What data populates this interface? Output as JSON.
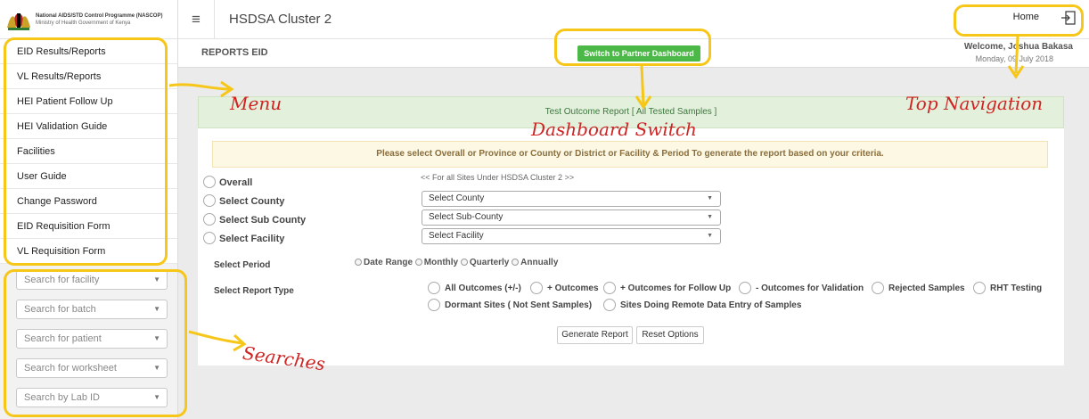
{
  "brand": {
    "line1": "National AIDS/STD Control Programme (NASCOP)",
    "line2": "Ministry of Health Government of Kenya"
  },
  "topbar": {
    "title": "HSDSA Cluster 2",
    "home_label": "Home"
  },
  "sidebar": {
    "menu": [
      {
        "label": "EID Results/Reports"
      },
      {
        "label": "VL Results/Reports"
      },
      {
        "label": "HEI Patient Follow Up"
      },
      {
        "label": "HEI Validation Guide"
      },
      {
        "label": "Facilities"
      },
      {
        "label": "User Guide"
      },
      {
        "label": "Change Password"
      },
      {
        "label": "EID Requisition Form"
      },
      {
        "label": "VL Requisition Form"
      }
    ],
    "searches": [
      {
        "placeholder": "Search for facility"
      },
      {
        "placeholder": "Search for batch"
      },
      {
        "placeholder": "Search for patient"
      },
      {
        "placeholder": "Search for worksheet"
      },
      {
        "placeholder": "Search by Lab ID"
      }
    ]
  },
  "subheader": {
    "title": "REPORTS EID",
    "switch_label": "Switch to Partner Dashboard",
    "welcome": "Welcome, Joshua Bakasa",
    "date": "Monday, 09 July 2018"
  },
  "report": {
    "header": "Test Outcome Report [ All Tested Samples ]",
    "notice": "Please select Overall or Province or County or District or Facility & Period To generate the report based on your criteria.",
    "overall_label": "Overall",
    "overall_note": "<< For all Sites Under HSDSA Cluster 2 >>",
    "county_label": "Select County",
    "county_value": "Select County",
    "subcounty_label": "Select Sub County",
    "subcounty_value": "Select Sub-County",
    "facility_label": "Select Facility",
    "facility_value": "Select Facility",
    "period_label": "Select Period",
    "period_options": [
      "Date Range",
      "Monthly",
      "Quarterly",
      "Annually"
    ],
    "report_type_label": "Select Report Type",
    "report_types": [
      "All Outcomes (+/-)",
      "+ Outcomes",
      "+ Outcomes for Follow Up",
      "- Outcomes for Validation",
      "Rejected Samples",
      "RHT Testing",
      "Dormant Sites ( Not Sent Samples)",
      "Sites Doing Remote Data Entry of Samples"
    ],
    "generate_label": "Generate Report",
    "reset_label": "Reset Options"
  },
  "annotations": {
    "menu": "Menu",
    "dashboard_switch": "Dashboard Switch",
    "top_navigation": "Top Navigation",
    "searches": "Searches",
    "color": "#f6c619",
    "text_color": "#d02424"
  },
  "colors": {
    "switch_green": "#4cb848",
    "notice_bg": "#fcf8e3",
    "header_bg": "#e3f1dc"
  }
}
